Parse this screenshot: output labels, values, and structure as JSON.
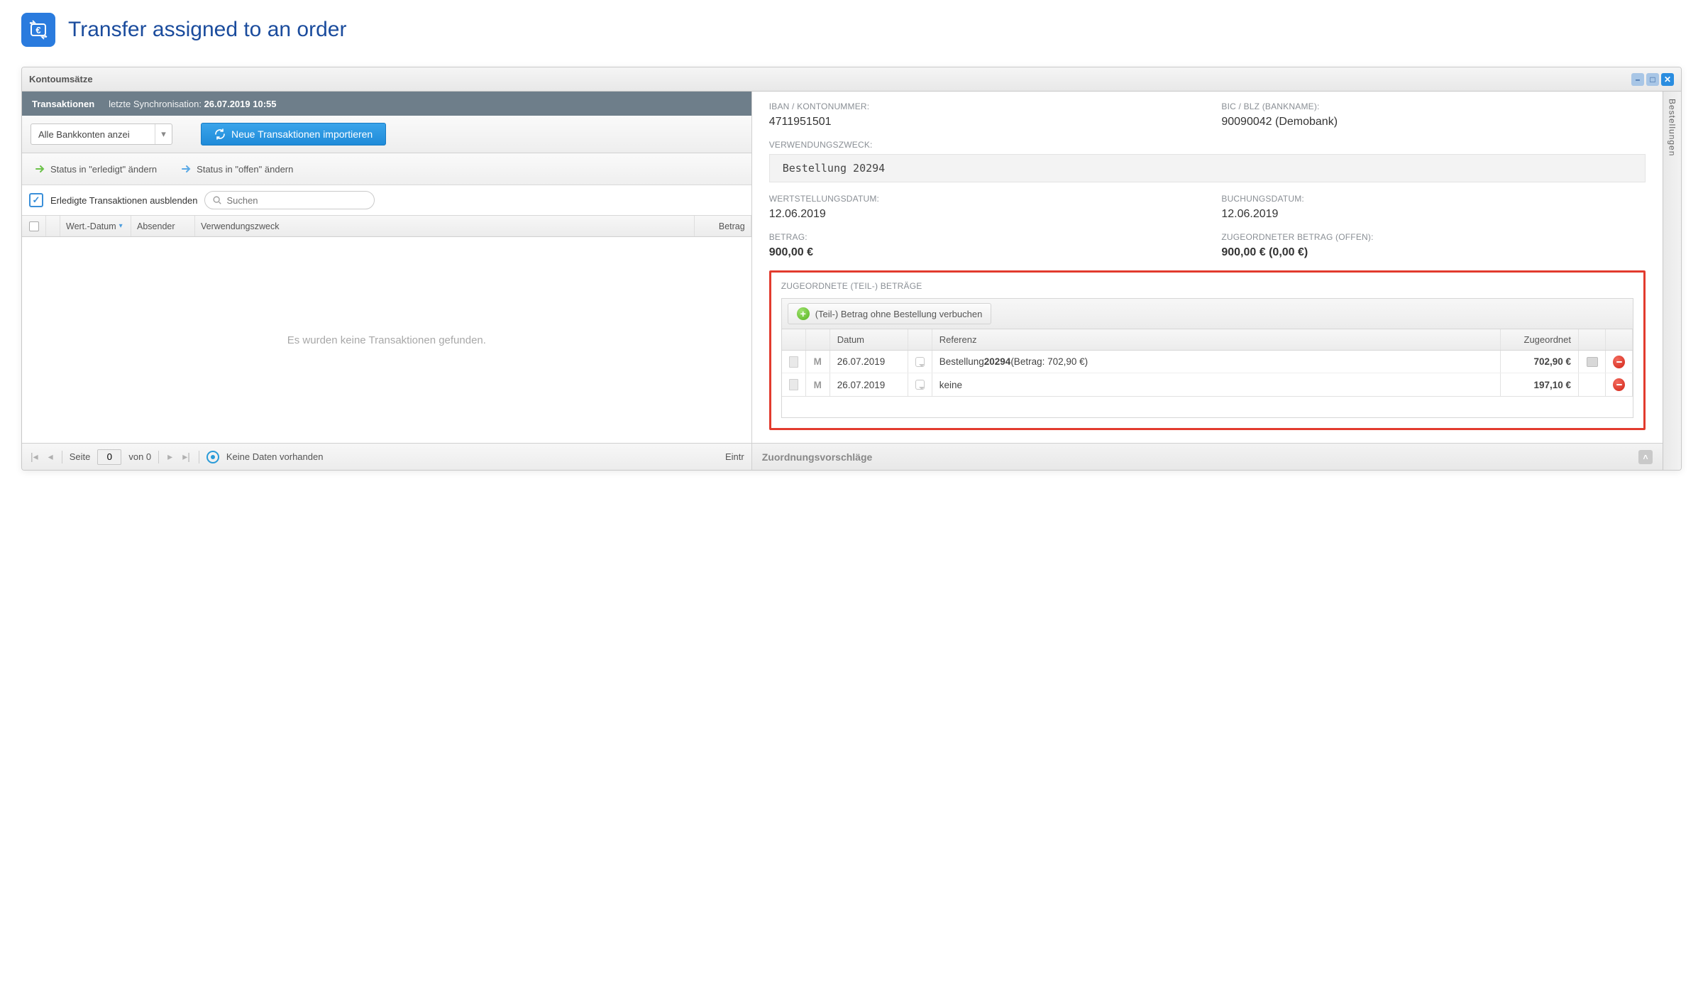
{
  "page": {
    "title": "Transfer assigned to an order"
  },
  "window": {
    "title": "Kontoumsätze"
  },
  "left": {
    "tabTitle": "Transaktionen",
    "syncLabel": "letzte Synchronisation:",
    "syncValue": "26.07.2019 10:55",
    "accountSelector": "Alle Bankkonten anzei",
    "importButton": "Neue Transaktionen importieren",
    "statusDoneBtn": "Status in \"erledigt\" ändern",
    "statusOpenBtn": "Status in \"offen\" ändern",
    "hideDoneLabel": "Erledigte Transaktionen ausblenden",
    "searchPlaceholder": "Suchen",
    "columns": {
      "date": "Wert.-Datum",
      "sender": "Absender",
      "purpose": "Verwendungszweck",
      "amount": "Betrag"
    },
    "emptyText": "Es wurden keine Transaktionen gefunden.",
    "pager": {
      "pageLabel": "Seite",
      "pageValue": "0",
      "ofLabel": "von 0",
      "statusText": "Keine Daten vorhanden",
      "rightText": "Eintr"
    }
  },
  "right": {
    "fields": {
      "ibanLabel": "IBAN / KONTONUMMER:",
      "ibanValue": "4711951501",
      "bicLabel": "BIC / BLZ (BANKNAME):",
      "bicValue": "90090042 (Demobank)",
      "purposeLabel": "VERWENDUNGSZWECK:",
      "purposeValue": "Bestellung 20294",
      "valueDateLabel": "WERTSTELLUNGSDATUM:",
      "valueDateValue": "12.06.2019",
      "bookingDateLabel": "BUCHUNGSDATUM:",
      "bookingDateValue": "12.06.2019",
      "amountLabel": "BETRAG:",
      "amountValue": "900,00 €",
      "assignedLabel": "ZUGEORDNETER BETRAG (OFFEN):",
      "assignedValue": "900,00 € (0,00 €)"
    },
    "assignedSection": {
      "title": "ZUGEORDNETE (TEIL-) BETRÄGE",
      "addBtn": "(Teil-) Betrag ohne Bestellung verbuchen",
      "columns": {
        "date": "Datum",
        "reference": "Referenz",
        "assigned": "Zugeordnet"
      },
      "rows": [
        {
          "date": "26.07.2019",
          "refPrefix": "Bestellung ",
          "refBold": "20294",
          "refSuffix": " (Betrag: 702,90 €)",
          "amount": "702,90 €",
          "hasPrint": true
        },
        {
          "date": "26.07.2019",
          "refPrefix": "keine",
          "refBold": "",
          "refSuffix": "",
          "amount": "197,10 €",
          "hasPrint": false
        }
      ]
    },
    "footer": "Zuordnungsvorschläge",
    "sideTab": "Bestellungen"
  }
}
